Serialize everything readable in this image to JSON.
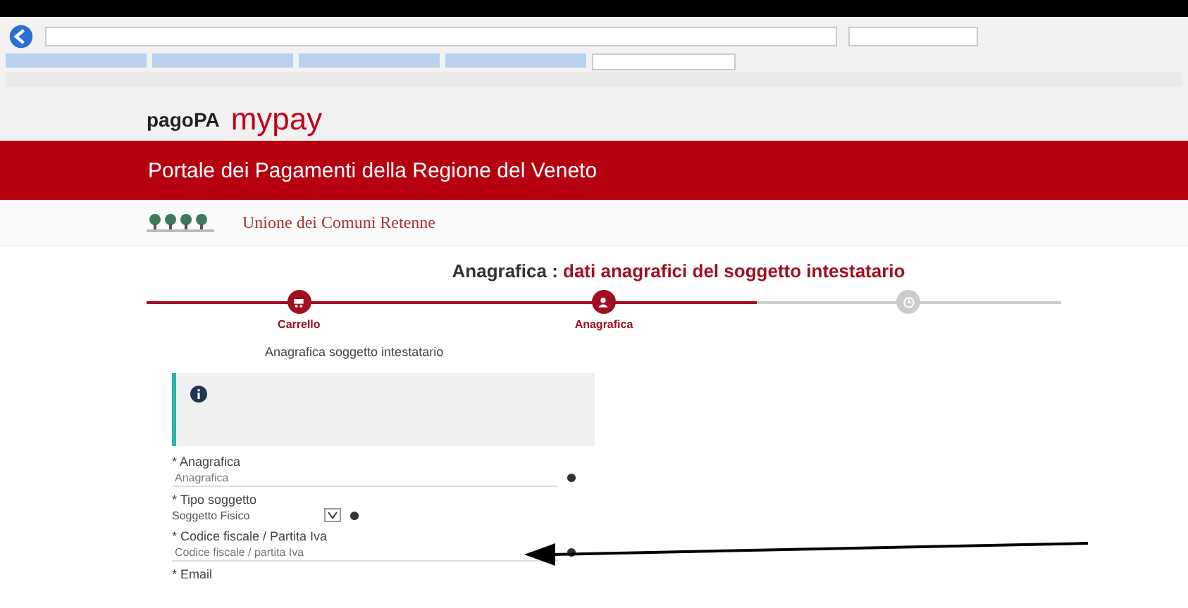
{
  "logo": {
    "brand": "pagoPA",
    "product": "mypay"
  },
  "banner": {
    "title": "Portale dei Pagamenti della Regione del Veneto"
  },
  "entity": {
    "name": "Unione dei Comuni Retenne"
  },
  "page_title": {
    "lead": "Anagrafica :",
    "rest": "dati anagrafici del soggetto intestatario"
  },
  "browser_tabs": [
    {
      "selected": false
    },
    {
      "selected": false
    },
    {
      "selected": false
    },
    {
      "selected": false
    },
    {
      "selected": true
    }
  ],
  "steps": [
    {
      "label": "Carrello",
      "done": true,
      "kind": "cart"
    },
    {
      "label": "Anagrafica",
      "done": true,
      "kind": "user"
    },
    {
      "done": false,
      "kind": "clock"
    }
  ],
  "section_title": "Anagrafica soggetto intestatario",
  "fields": [
    {
      "label": "* Anagrafica",
      "kind": "text",
      "placeholder": "Anagrafica"
    },
    {
      "label": "* Tipo soggetto",
      "kind": "select",
      "value": "Soggetto Fisico"
    },
    {
      "label": "* Codice fiscale / Partita Iva",
      "kind": "text",
      "placeholder": "Codice fiscale / partita Iva"
    },
    {
      "label": "* Email",
      "kind": "cut"
    }
  ]
}
